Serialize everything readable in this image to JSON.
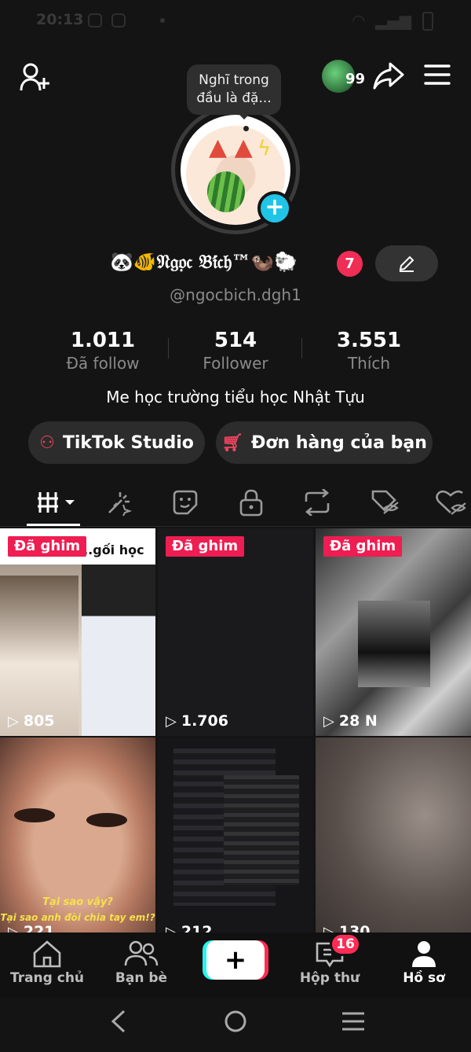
{
  "status_bar": {
    "time": "20:13"
  },
  "header": {
    "add_friend_icon": "person-plus-icon",
    "share_icon": "share-arrow-icon",
    "menu_icon": "hamburger-menu-icon",
    "notification_count": "99"
  },
  "profile": {
    "note": "Nghĩ trong đầu là đặ...",
    "display_name": "🐼🐠𝔑𝔤𝔬̣𝔠 𝔅𝔦́𝔠𝔥™🦦🐑",
    "name_badge": "7",
    "handle": "@ngocbich.dgh1",
    "bio": "Me học trường tiểu học Nhật Tựu"
  },
  "stats": [
    {
      "value": "1.011",
      "label": "Đã follow"
    },
    {
      "value": "514",
      "label": "Follower"
    },
    {
      "value": "3.551",
      "label": "Thích"
    }
  ],
  "actions": {
    "studio_label": "TikTok Studio",
    "orders_label": "Đơn hàng của bạn"
  },
  "tabs": [
    "videos-grid-icon",
    "reposts-sparkle-icon",
    "stickers-icon",
    "lock-icon",
    "repost-icon",
    "hidden-tag-icon",
    "liked-hidden-icon"
  ],
  "videos": [
    {
      "views": "805",
      "pinned": "Đã ghim",
      "overlay": "...gối học"
    },
    {
      "views": "1.706",
      "pinned": "Đã ghim"
    },
    {
      "views": "28 N",
      "pinned": "Đã ghim"
    },
    {
      "views": "221",
      "caption1": "Tại sao vậy?",
      "caption2": "Tại sao anh đòi chia tay em!?"
    },
    {
      "views": "212"
    },
    {
      "views": "130"
    }
  ],
  "bottom_nav": {
    "home": "Trang chủ",
    "friends": "Bạn bè",
    "inbox": "Hộp thư",
    "inbox_badge": "16",
    "profile": "Hồ sơ"
  },
  "colors": {
    "accent": "#fe2c55",
    "cyan": "#25f4ee",
    "background": "#141414"
  }
}
